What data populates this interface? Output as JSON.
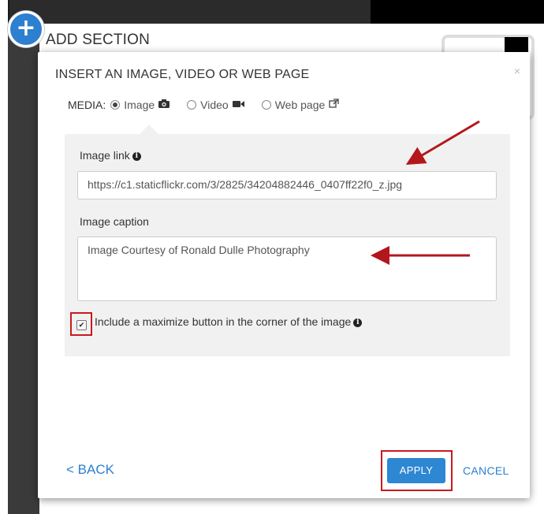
{
  "header": {
    "plus_symbol": "+",
    "title": "ADD SECTION"
  },
  "dialog": {
    "title": "INSERT AN IMAGE, VIDEO OR WEB PAGE",
    "close_symbol": "×",
    "media": {
      "label": "MEDIA:",
      "options": [
        {
          "label": "Image",
          "icon": "camera-icon",
          "selected": true
        },
        {
          "label": "Video",
          "icon": "video-camera-icon",
          "selected": false
        },
        {
          "label": "Web page",
          "icon": "external-link-icon",
          "selected": false
        }
      ]
    },
    "image_link": {
      "label": "Image link",
      "value": "https://c1.staticflickr.com/3/2825/34204882446_0407ff22f0_z.jpg"
    },
    "image_caption": {
      "label": "Image caption",
      "value": "Image Courtesy of Ronald Dulle Photography"
    },
    "maximize": {
      "label": "Include a maximize button in the corner of the image",
      "checked": true
    },
    "back_label": "< BACK",
    "apply_label": "APPLY",
    "cancel_label": "CANCEL"
  },
  "colors": {
    "accent": "#2d87d2",
    "highlight": "#c9191e",
    "annotation_arrow": "#b3171b"
  }
}
